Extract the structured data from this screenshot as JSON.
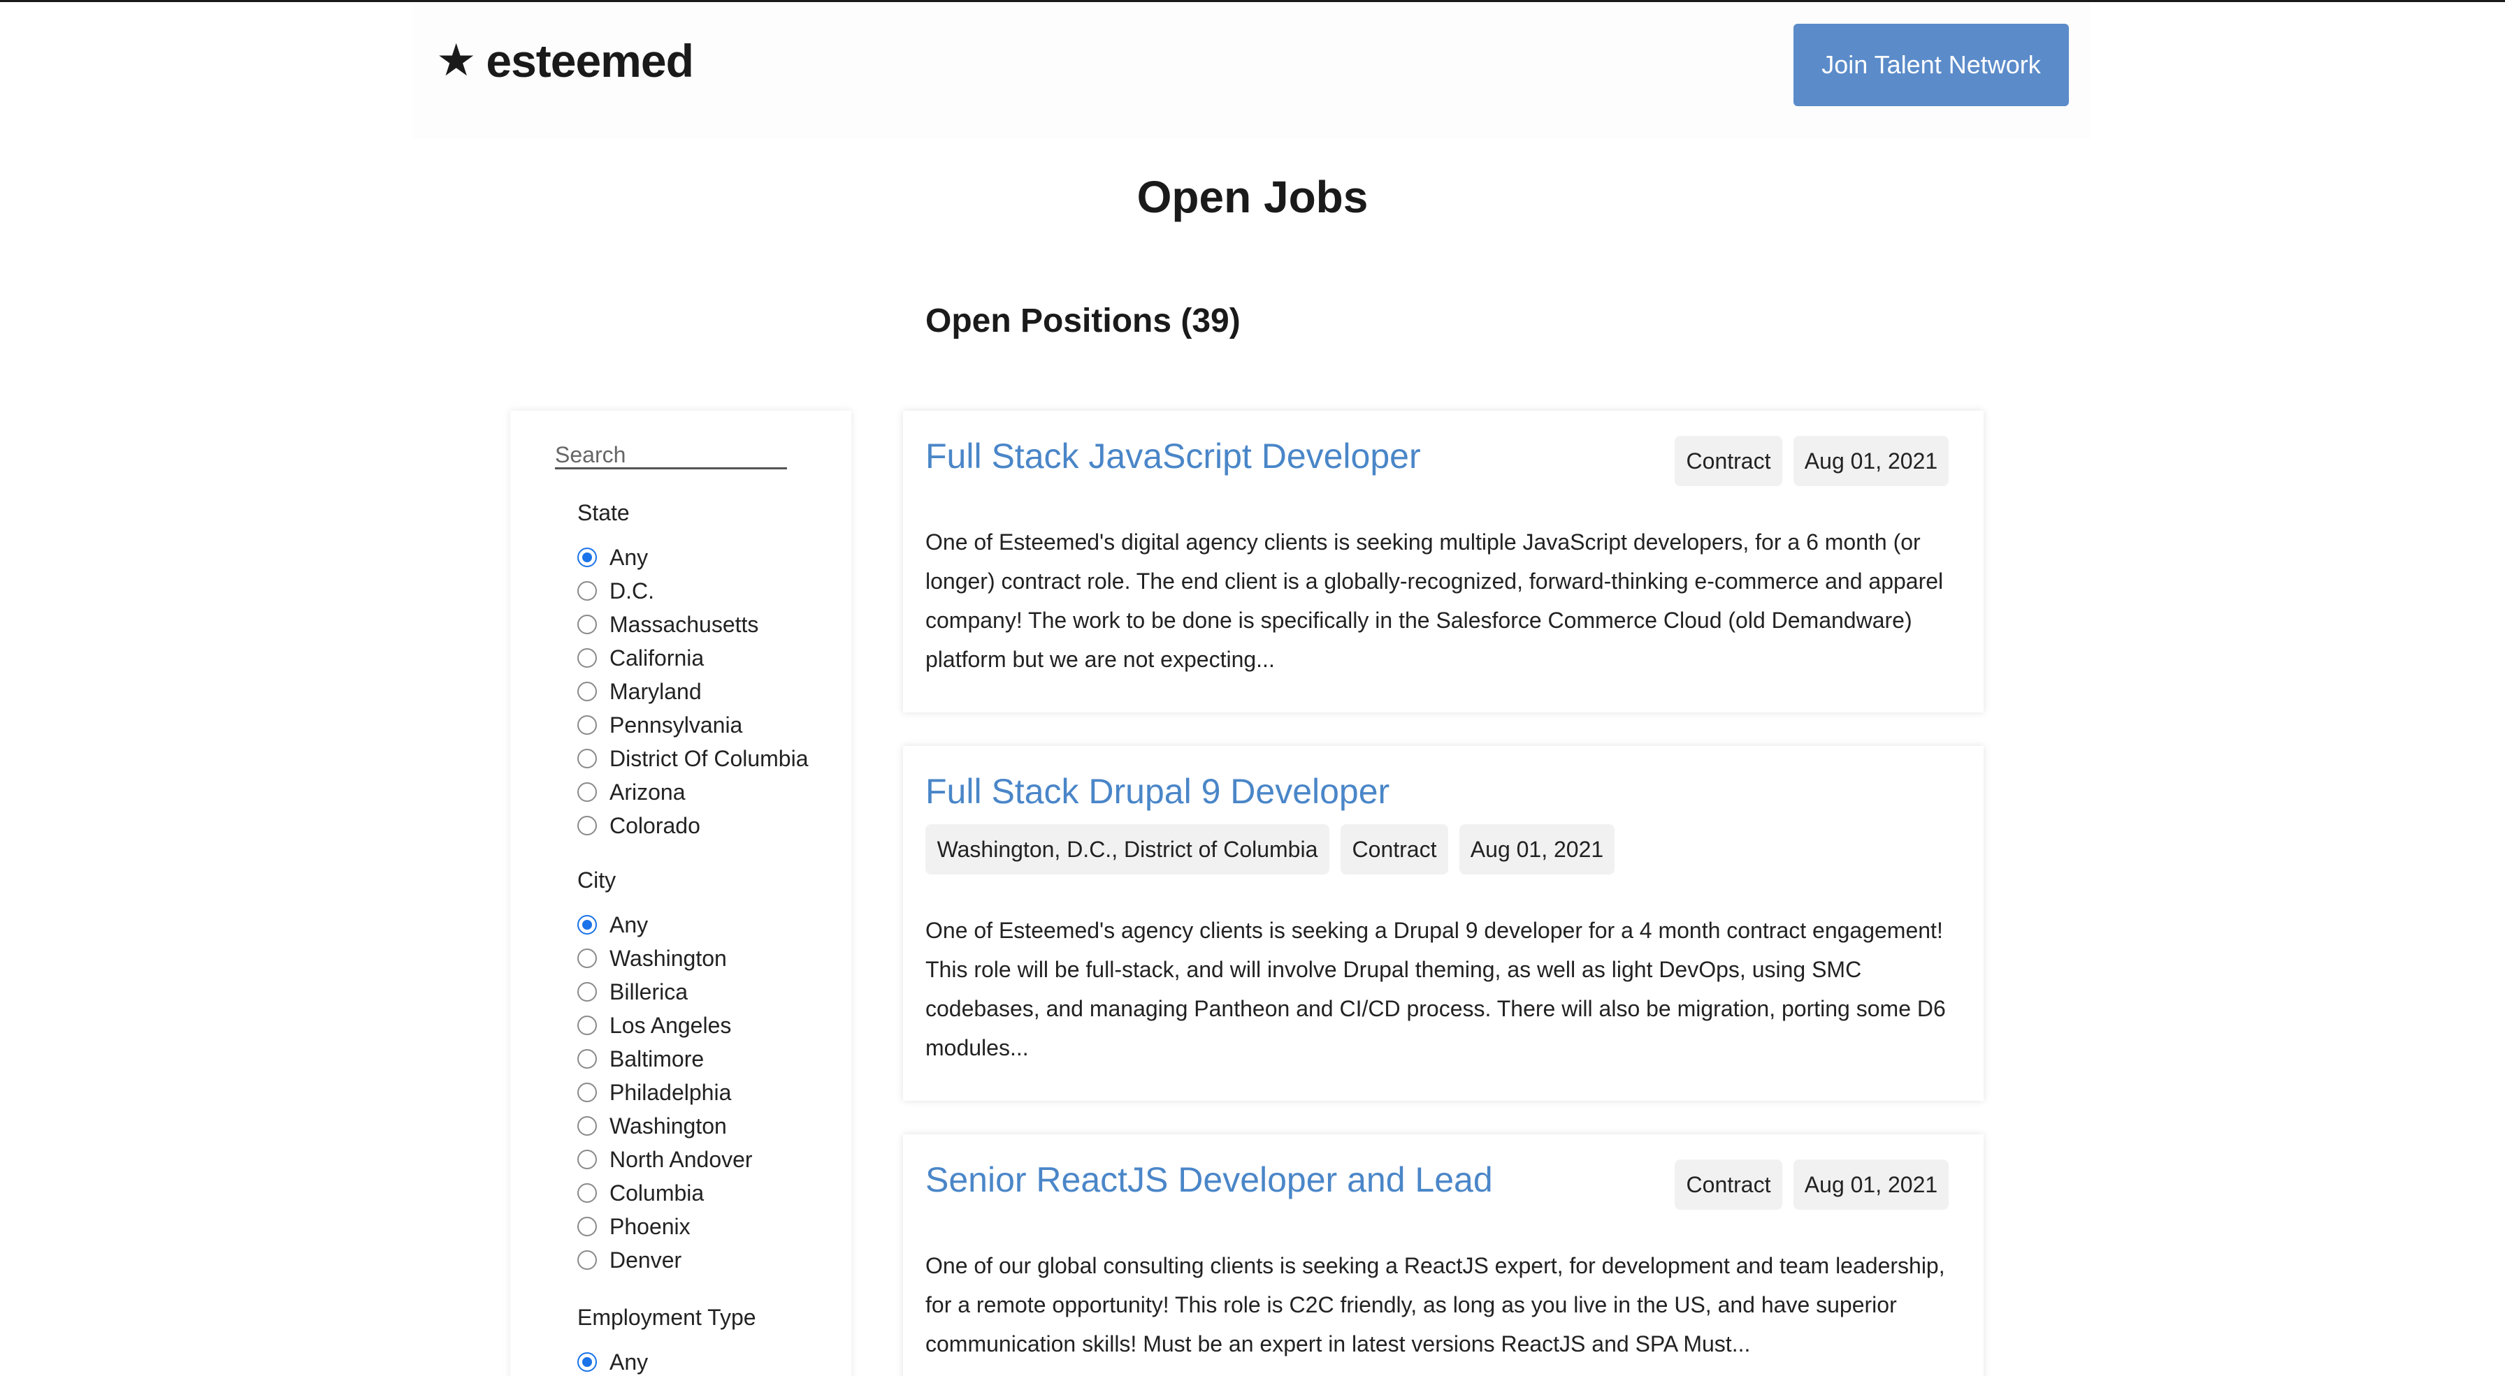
{
  "header": {
    "logo_star": "★",
    "logo_text": "esteemed",
    "join_label": "Join Talent Network"
  },
  "page": {
    "title": "Open Jobs",
    "positions_heading": "Open Positions (39)"
  },
  "sidebar": {
    "search_placeholder": "Search",
    "state": {
      "title": "State",
      "selected": "Any",
      "options": [
        "Any",
        "D.C.",
        "Massachusetts",
        "California",
        "Maryland",
        "Pennsylvania",
        "District Of Columbia",
        "Arizona",
        "Colorado"
      ]
    },
    "city": {
      "title": "City",
      "selected": "Any",
      "options": [
        "Any",
        "Washington",
        "Billerica",
        "Los Angeles",
        "Baltimore",
        "Philadelphia",
        "Washington",
        "North Andover",
        "Columbia",
        "Phoenix",
        "Denver"
      ]
    },
    "employment_type": {
      "title": "Employment Type",
      "selected": "Any",
      "options": [
        "Any"
      ]
    }
  },
  "jobs": [
    {
      "title": "Full Stack JavaScript Developer",
      "type": "Contract",
      "date": "Aug 01, 2021",
      "description": "One of Esteemed's digital agency clients is seeking multiple JavaScript developers, for a 6 month (or longer) contract role. The end client is a globally-recognized, forward-thinking e-commerce and apparel company! The work to be done is specifically in the Salesforce Commerce Cloud (old Demandware) platform but we are not expecting..."
    },
    {
      "title": "Full Stack Drupal 9 Developer",
      "location": "Washington, D.C., District of Columbia",
      "type": "Contract",
      "date": "Aug 01, 2021",
      "description": "One of Esteemed's agency clients is seeking a Drupal 9 developer for a 4 month contract engagement! This role will be full-stack, and will involve Drupal theming, as well as light DevOps, using SMC codebases, and managing Pantheon and CI/CD process. There will also be migration, porting some D6 modules..."
    },
    {
      "title": "Senior ReactJS Developer and Lead",
      "type": "Contract",
      "date": "Aug 01, 2021",
      "description": "One of our global consulting clients is seeking a ReactJS expert, for development and team leadership, for a remote opportunity! This role is C2C friendly, as long as you live in the US, and have superior communication skills!   Must be an expert in latest versions ReactJS and SPA Must..."
    }
  ],
  "colors": {
    "accent": "#4a86c8",
    "button": "#5b8bc9",
    "radio_selected": "#1a73e8",
    "tag_bg": "#f1f1f1"
  }
}
